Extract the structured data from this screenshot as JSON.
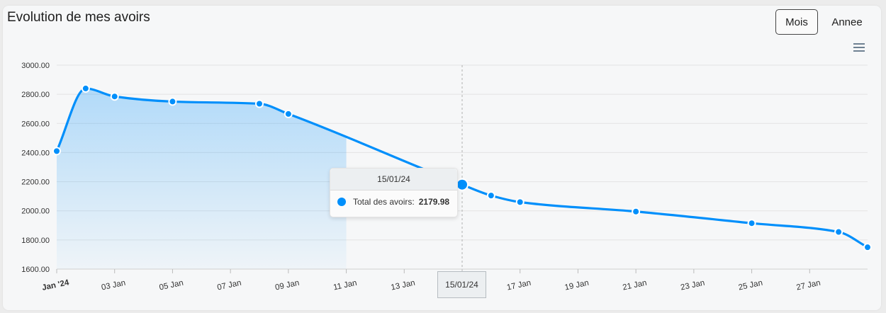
{
  "header": {
    "title": "Evolution de mes avoirs",
    "buttons": {
      "month": "Mois",
      "year": "Annee"
    }
  },
  "colors": {
    "series": "#008ffb",
    "grid": "#e3e3e3"
  },
  "icons": {
    "menu": "hamburger-menu-icon"
  },
  "tooltip": {
    "date": "15/01/24",
    "series_label": "Total des avoirs:",
    "value": "2179.98"
  },
  "crosshair_label": "15/01/24",
  "chart_data": {
    "type": "area",
    "title": "Evolution de mes avoirs",
    "xlabel": "",
    "ylabel": "",
    "x_range": [
      "2024-01-01",
      "2024-01-29"
    ],
    "ylim": [
      1600,
      3000
    ],
    "y_ticks": [
      "3000.00",
      "2800.00",
      "2600.00",
      "2400.00",
      "2200.00",
      "2000.00",
      "1800.00",
      "1600.00"
    ],
    "x_ticks": [
      {
        "date": "2024-01-01",
        "label": "Jan '24",
        "bold": true
      },
      {
        "date": "2024-01-03",
        "label": "03 Jan"
      },
      {
        "date": "2024-01-05",
        "label": "05 Jan"
      },
      {
        "date": "2024-01-07",
        "label": "07 Jan"
      },
      {
        "date": "2024-01-09",
        "label": "09 Jan"
      },
      {
        "date": "2024-01-11",
        "label": "11 Jan"
      },
      {
        "date": "2024-01-13",
        "label": "13 Jan"
      },
      {
        "date": "2024-01-15",
        "label": "15 Jan"
      },
      {
        "date": "2024-01-17",
        "label": "17 Jan"
      },
      {
        "date": "2024-01-19",
        "label": "19 Jan"
      },
      {
        "date": "2024-01-21",
        "label": "21 Jan"
      },
      {
        "date": "2024-01-23",
        "label": "23 Jan"
      },
      {
        "date": "2024-01-25",
        "label": "25 Jan"
      },
      {
        "date": "2024-01-27",
        "label": "27 Jan"
      }
    ],
    "grid": true,
    "series": [
      {
        "name": "Total des avoirs",
        "points": [
          {
            "x": "2024-01-01",
            "y": 2410
          },
          {
            "x": "2024-01-02",
            "y": 2840
          },
          {
            "x": "2024-01-03",
            "y": 2785
          },
          {
            "x": "2024-01-05",
            "y": 2750
          },
          {
            "x": "2024-01-08",
            "y": 2735
          },
          {
            "x": "2024-01-09",
            "y": 2665
          },
          {
            "x": "2024-01-15",
            "y": 2179.98
          },
          {
            "x": "2024-01-16",
            "y": 2105
          },
          {
            "x": "2024-01-17",
            "y": 2060
          },
          {
            "x": "2024-01-21",
            "y": 1995
          },
          {
            "x": "2024-01-25",
            "y": 1915
          },
          {
            "x": "2024-01-28",
            "y": 1855
          },
          {
            "x": "2024-01-29",
            "y": 1750
          }
        ],
        "area_until": "2024-01-11",
        "highlighted": "2024-01-15"
      }
    ]
  }
}
